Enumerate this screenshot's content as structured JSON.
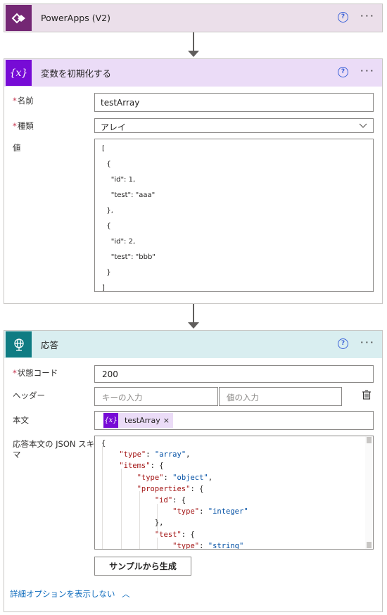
{
  "trigger": {
    "title": "PowerApps (V2)",
    "help": "?",
    "more": "···"
  },
  "init_var": {
    "title": "変数を初期化する",
    "help": "?",
    "more": "···",
    "name_label": "名前",
    "name_value": "testArray",
    "type_label": "種類",
    "type_value": "アレイ",
    "value_label": "値",
    "value_lines": [
      "[",
      "  {",
      "    \"id\": 1,",
      "    \"test\": \"aaa\"",
      "  },",
      "  {",
      "    \"id\": 2,",
      "    \"test\": \"bbb\"",
      "  }",
      "]"
    ]
  },
  "response": {
    "title": "応答",
    "help": "?",
    "more": "···",
    "status_label": "状態コード",
    "status_value": "200",
    "headers_label": "ヘッダー",
    "key_placeholder": "キーの入力",
    "value_placeholder": "値の入力",
    "body_label": "本文",
    "body_token": "testArray",
    "token_close": "×",
    "schema_label_1": "応答本文の JSON スキー",
    "schema_label_2": "マ",
    "schema_lines": [
      "{",
      "    \"type\": \"array\",",
      "    \"items\": {",
      "        \"type\": \"object\",",
      "        \"properties\": {",
      "            \"id\": {",
      "                \"type\": \"integer\"",
      "            },",
      "            \"test\": {",
      "                \"type\": \"string\""
    ],
    "generate_button": "サンプルから生成",
    "advanced_link": "詳細オプションを表示しない",
    "advanced_chevron": "︿"
  },
  "colors": {
    "powerapps": "#742774",
    "variable": "#770bd6",
    "response": "#0f7c83",
    "trigger_bg": "#ebdfea",
    "init_bg": "#ebdcf7",
    "response_bg": "#d9eef0"
  }
}
